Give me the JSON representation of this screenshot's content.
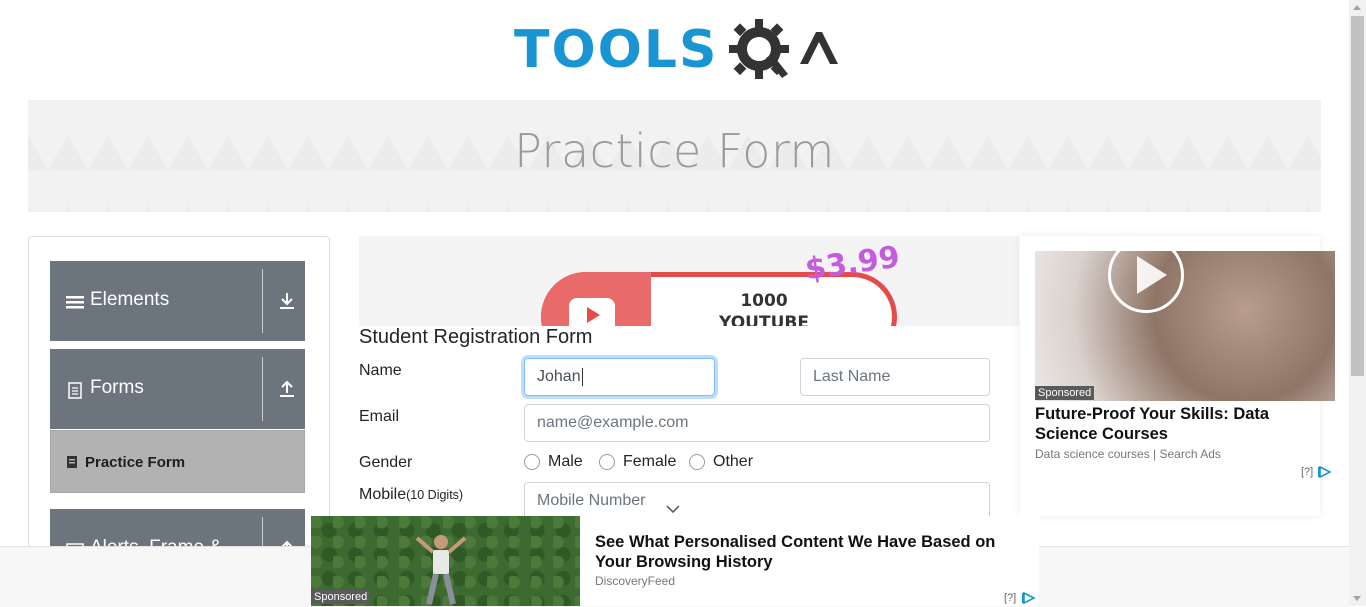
{
  "header": {
    "logo_text": "TOOLS",
    "logo_suffix": "QA",
    "colors": {
      "logo_blue": "#1a95d4",
      "logo_dark": "#333333"
    }
  },
  "banner": {
    "title": "Practice Form"
  },
  "sidebar": {
    "groups": [
      {
        "label": "Elements",
        "icon": "hamburger-icon",
        "arrow": "download-arrow-icon"
      },
      {
        "label": "Forms",
        "icon": "document-icon",
        "arrow": "upload-arrow-icon"
      },
      {
        "label": "Alerts, Frame &",
        "icon": "window-icon",
        "arrow": "upload-arrow-icon"
      }
    ],
    "active_item": {
      "label": "Practice Form",
      "icon": "clipboard-icon"
    },
    "colors": {
      "group_bg": "#6c757d",
      "active_bg": "#b2b2b2"
    }
  },
  "top_ad": {
    "count": "1000",
    "subtitle": "YOUTUBE VIEWS",
    "price": "$3.99"
  },
  "form": {
    "title": "Student Registration Form",
    "name_label": "Name",
    "first_name_value": "Johan",
    "last_name_placeholder": "Last Name",
    "email_label": "Email",
    "email_placeholder": "name@example.com",
    "gender_label": "Gender",
    "gender_options": [
      "Male",
      "Female",
      "Other"
    ],
    "mobile_label": "Mobile",
    "mobile_hint": "(10 Digits)",
    "mobile_placeholder": "Mobile Number"
  },
  "right_ad": {
    "sponsored": "Sponsored",
    "title": "Future-Proof Your Skills: Data Science Courses",
    "subtitle": "Data science courses | Search Ads",
    "help": "[?]"
  },
  "bottom_ad": {
    "sponsored": "Sponsored",
    "title": "See What Personalised Content We Have Based on Your Browsing History",
    "source": "DiscoveryFeed",
    "help": "[?]"
  }
}
